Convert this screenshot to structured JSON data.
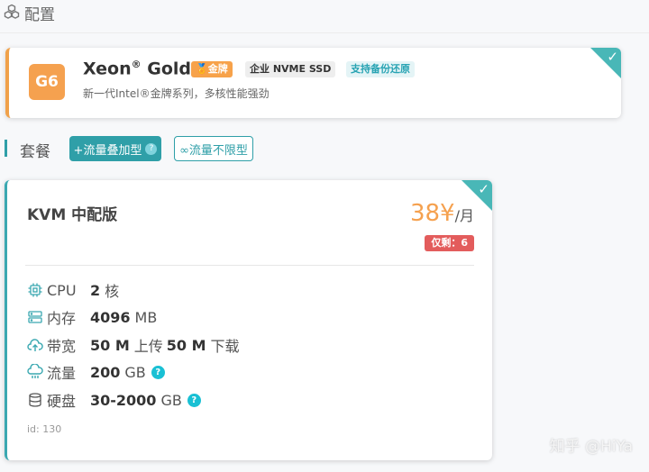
{
  "header": {
    "title": "配置",
    "icon": "cubes-icon"
  },
  "cpu": {
    "tag": "G6",
    "name": "Xeon",
    "reg": "®",
    "name_suffix": " Gold",
    "badges": {
      "gold": "金牌",
      "ssd": "企业 NVME SSD",
      "backup": "支持备份还原"
    },
    "desc": "新一代Intel®金牌系列，多核性能强劲",
    "accent": "#f5a14f"
  },
  "packages": {
    "label": "套餐",
    "tab_active": "+流量叠加型",
    "tab_inactive": "∞流量不限型"
  },
  "plan": {
    "name": "KVM 中配版",
    "price": "38¥",
    "price_unit": "/月",
    "stock": "仅剩：6",
    "specs": {
      "cpu": {
        "label": "CPU",
        "value": "2",
        "unit": "核"
      },
      "mem": {
        "label": "内存",
        "value": "4096",
        "unit": "MB"
      },
      "bw": {
        "label": "带宽",
        "value1": "50 M",
        "unit1": "上传",
        "value2": "50 M",
        "unit2": "下载"
      },
      "traffic": {
        "label": "流量",
        "value": "200",
        "unit": "GB"
      },
      "disk": {
        "label": "硬盘",
        "value": "30-2000",
        "unit": "GB"
      }
    },
    "id": "id: 130",
    "accent": "#2f9fa8"
  },
  "watermark": "知乎 @HiYa"
}
